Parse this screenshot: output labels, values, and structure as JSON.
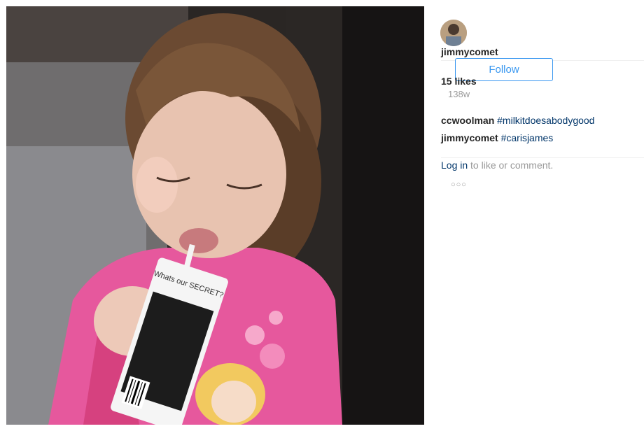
{
  "post": {
    "photo_alt": "Photo by jimmycomet",
    "drink_carton_text": "Whats our SECRET?"
  },
  "header": {
    "username": "jimmycomet",
    "follow_label": "Follow"
  },
  "stats": {
    "likes": "15 likes",
    "time_ago": "138w"
  },
  "comments": [
    {
      "author": "ccwoolman",
      "text": "#milkitdoesabodygood"
    },
    {
      "author": "jimmycomet",
      "text": "#carisjames"
    }
  ],
  "login_prompt": {
    "link_label": "Log in",
    "rest": " to like or comment."
  },
  "more_options": "○○○",
  "colors": {
    "accent": "#3897f0",
    "link": "#003569",
    "muted": "#999999",
    "pajama_pink": "#e6589d"
  },
  "icons": {
    "more": "more-options-icon"
  }
}
